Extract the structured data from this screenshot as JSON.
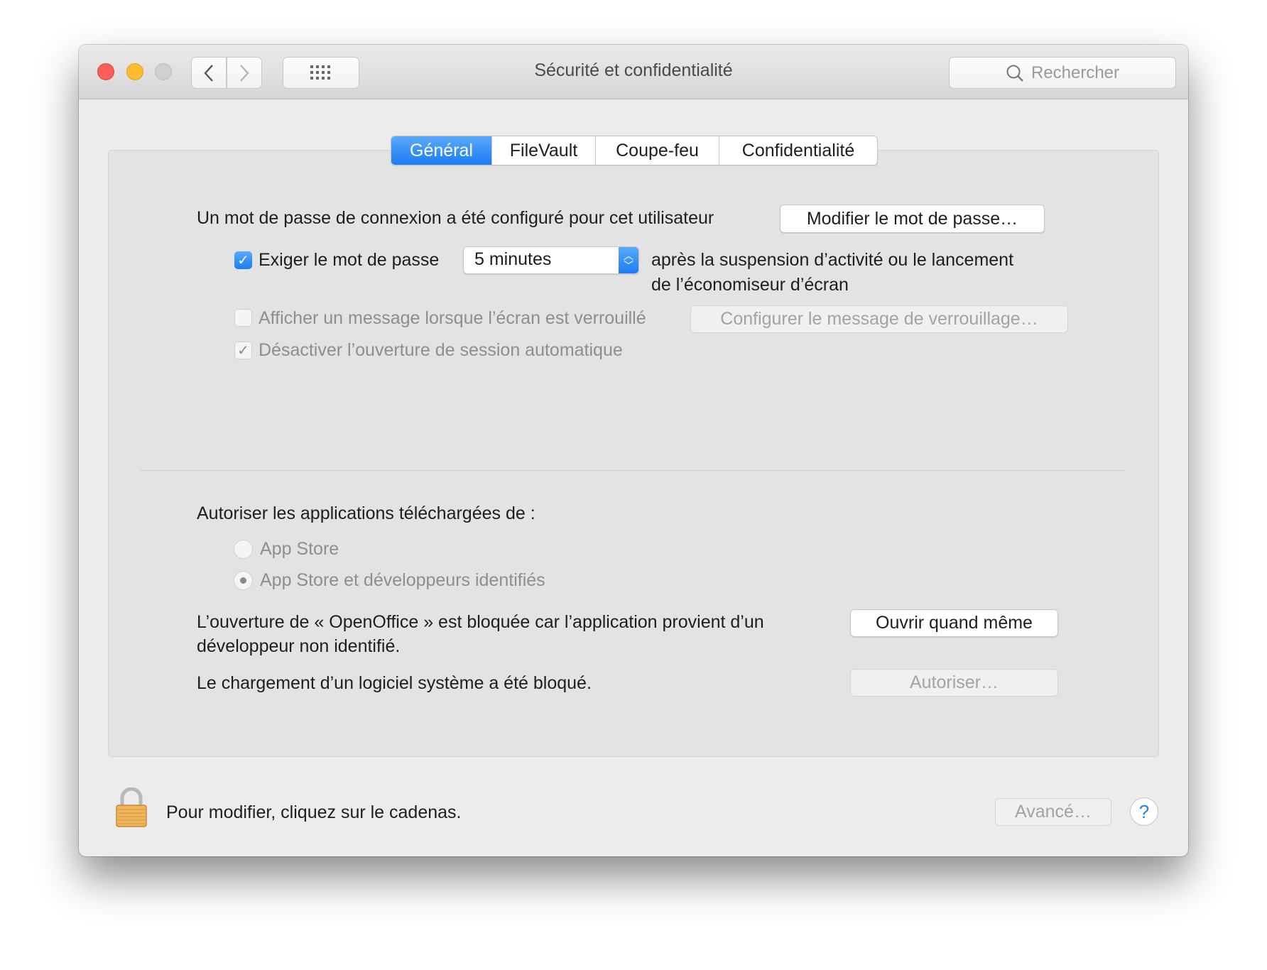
{
  "window": {
    "title": "Sécurité et confidentialité",
    "search_placeholder": "Rechercher"
  },
  "tabs": [
    {
      "label": "Général",
      "active": true
    },
    {
      "label": "FileVault",
      "active": false
    },
    {
      "label": "Coupe-feu",
      "active": false
    },
    {
      "label": "Confidentialité",
      "active": false
    }
  ],
  "general": {
    "password_set_text": "Un mot de passe de connexion a été configuré pour cet utilisateur",
    "change_password_button": "Modifier le mot de passe…",
    "require_password": {
      "label": "Exiger le mot de passe",
      "checked": true,
      "delay": "5 minutes",
      "suffix_line1": "après la suspension d’activité ou le lancement",
      "suffix_line2": "de l’économiseur d’écran"
    },
    "show_message": {
      "label": "Afficher un message lorsque l’écran est verrouillé",
      "checked": false,
      "button": "Configurer le message de verrouillage…"
    },
    "disable_autologin": {
      "label": "Désactiver l’ouverture de session automatique",
      "checked": true
    },
    "allow_apps_label": "Autoriser les applications téléchargées de :",
    "allow_options": [
      {
        "label": "App Store",
        "selected": false
      },
      {
        "label": "App Store et développeurs identifiés",
        "selected": true
      }
    ],
    "blocked_app_line1": "L’ouverture de « OpenOffice » est bloquée car l’application provient d’un",
    "blocked_app_line2": "développeur non identifié.",
    "open_anyway_button": "Ouvrir quand même",
    "system_software_text": "Le chargement d’un logiciel système a été bloqué.",
    "allow_button": "Autoriser…"
  },
  "footer": {
    "lock_text": "Pour modifier, cliquez sur le cadenas.",
    "advanced_button": "Avancé…",
    "help_label": "?"
  },
  "colors": {
    "accent": "#1c7cf2",
    "close": "#fc5f57",
    "minimize": "#fdbc2e",
    "lock": "#f0b55a"
  }
}
